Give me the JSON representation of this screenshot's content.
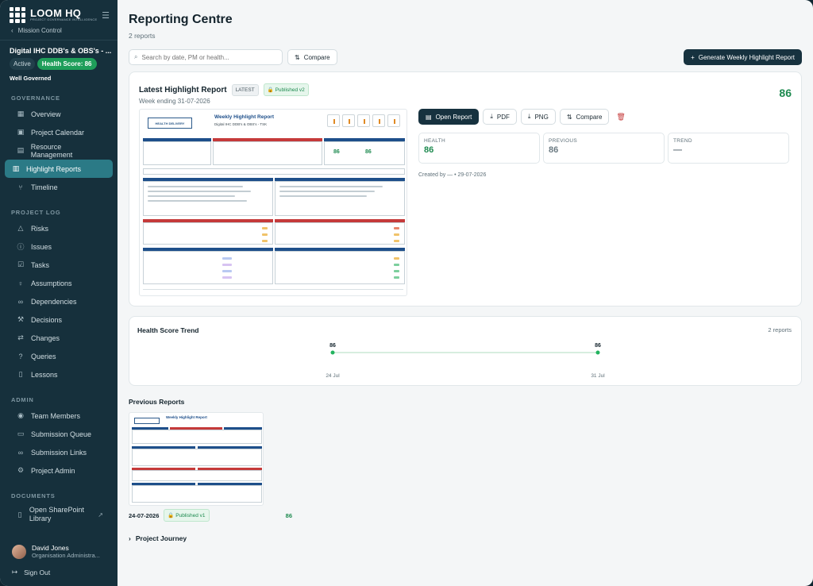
{
  "brand": {
    "name": "LOOM HQ",
    "subtitle": "PROJECT GOVERNANCE INTELLIGENCE"
  },
  "sidebar": {
    "back_label": "Mission Control",
    "project_title": "Digital IHC DDB's & OBS's - ...",
    "status": "Active",
    "health_badge": "Health Score: 86",
    "governance_status": "Well Governed",
    "sections": {
      "governance": "GOVERNANCE",
      "project_log": "PROJECT LOG",
      "admin": "ADMIN",
      "documents": "DOCUMENTS"
    },
    "governance_items": [
      "Overview",
      "Project Calendar",
      "Resource Management",
      "Highlight Reports",
      "Timeline"
    ],
    "project_log_items": [
      "Risks",
      "Issues",
      "Tasks",
      "Assumptions",
      "Dependencies",
      "Decisions",
      "Changes",
      "Queries",
      "Lessons"
    ],
    "admin_items": [
      "Team Members",
      "Submission Queue",
      "Submission Links",
      "Project Admin"
    ],
    "documents_item": "Open SharePoint Library",
    "user": {
      "name": "David Jones",
      "role": "Organisation Administra..."
    },
    "signout": "Sign Out"
  },
  "page": {
    "title": "Reporting Centre",
    "subtitle": "2 reports",
    "search_placeholder": "Search by date, PM or health...",
    "compare_label": "Compare",
    "generate_label": "Generate Weekly Highlight Report"
  },
  "latest": {
    "title": "Latest Highlight Report",
    "tag": "LATEST",
    "published": "Published v2",
    "week": "Week ending 31-07-2026",
    "score": "86",
    "actions": {
      "open": "Open Report",
      "pdf": "PDF",
      "png": "PNG",
      "compare": "Compare"
    },
    "metrics": [
      {
        "label": "HEALTH",
        "value": "86",
        "color": "#1d8a4f"
      },
      {
        "label": "PREVIOUS",
        "value": "86",
        "color": "#6b7a82"
      },
      {
        "label": "TREND",
        "value": "—",
        "color": "#6b7a82"
      }
    ],
    "created": "Created by — • 29-07-2026",
    "thumb": {
      "logo": "HEALTH DELIVERY",
      "title": "Weekly Highlight Report",
      "subtitle": "Digital IHC DDB's & OBS's - TSK",
      "left_score": "86",
      "right_score": "86"
    }
  },
  "trend": {
    "title": "Health Score Trend",
    "count": "2 reports"
  },
  "chart_data": {
    "type": "line",
    "title": "Health Score Trend",
    "x": [
      "24 Jul",
      "31 Jul"
    ],
    "series": [
      {
        "values": [
          86,
          86
        ]
      }
    ],
    "data_labels": [
      "86",
      "86"
    ],
    "point_color": "#22b35e",
    "line_color": "#bfe3cc"
  },
  "previous": {
    "title": "Previous Reports",
    "items": [
      {
        "date": "24-07-2026",
        "published": "Published v1",
        "score": "86",
        "thumb_title": "Weekly Highlight Report"
      }
    ],
    "journey": "Project Journey"
  }
}
